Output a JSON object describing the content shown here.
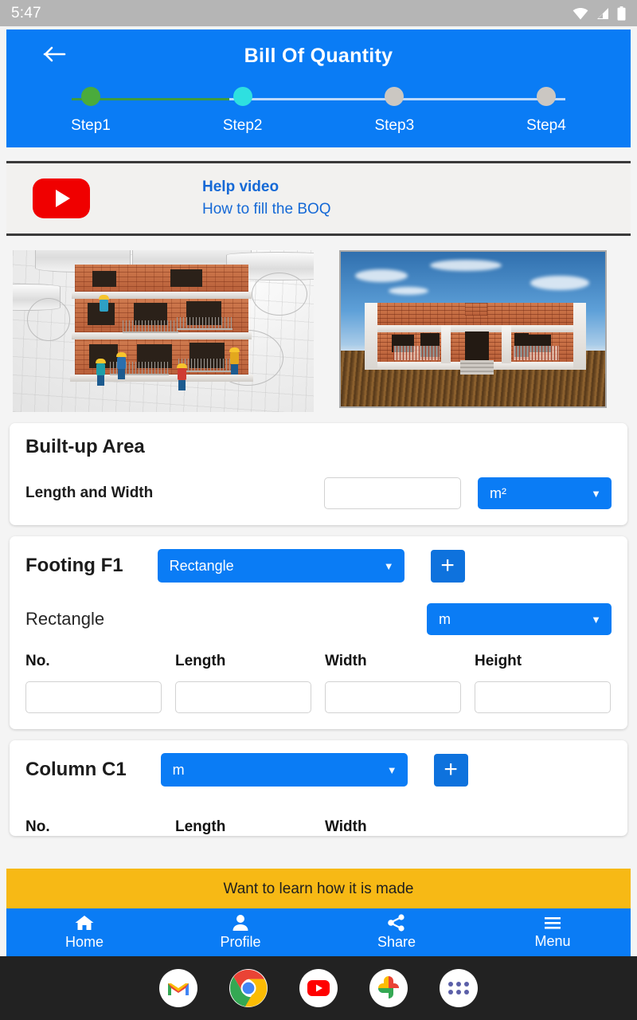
{
  "status_bar": {
    "time": "5:47",
    "icons": [
      "wifi-icon",
      "cellular-signal-icon",
      "battery-icon"
    ]
  },
  "header": {
    "back_icon": "arrow-left-icon",
    "title": "Bill Of Quantity",
    "colors": {
      "bar": "#0a7cf5",
      "step_done": "#4aab3c",
      "step_current": "#2ee0e0",
      "step_pending": "#cbc7c2"
    },
    "steps": [
      {
        "label": "Step1",
        "state": "done"
      },
      {
        "label": "Step2",
        "state": "current"
      },
      {
        "label": "Step3",
        "state": "pending"
      },
      {
        "label": "Step4",
        "state": "pending"
      }
    ]
  },
  "help_video": {
    "icon": "youtube-play-icon",
    "title": "Help video",
    "subtitle": "How to fill the BOQ"
  },
  "images": [
    {
      "name": "building-construction-blueprint-image",
      "alt": "3D building under construction on blueprints"
    },
    {
      "name": "house-render-image",
      "alt": "Rendered brick house exterior"
    }
  ],
  "built_up_area": {
    "title": "Built-up Area",
    "field_label": "Length and Width",
    "value": "",
    "placeholder": "",
    "unit": "m²"
  },
  "footing": {
    "title": "Footing F1",
    "shape": "Rectangle",
    "add_label": "+",
    "sub_label": "Rectangle",
    "unit": "m",
    "columns": [
      "No.",
      "Length",
      "Width",
      "Height"
    ],
    "values": [
      "",
      "",
      "",
      ""
    ]
  },
  "column": {
    "title": "Column C1",
    "unit": "m",
    "add_label": "+",
    "columns": [
      "No.",
      "Length",
      "Width"
    ]
  },
  "banner": {
    "text": "Want to learn how it is made",
    "color": "#f7b915"
  },
  "bottom_nav": [
    {
      "label": "Home",
      "icon": "home-icon"
    },
    {
      "label": "Profile",
      "icon": "person-icon"
    },
    {
      "label": "Share",
      "icon": "share-icon"
    },
    {
      "label": "Menu",
      "icon": "hamburger-menu-icon"
    }
  ],
  "dock": [
    {
      "name": "gmail-icon"
    },
    {
      "name": "chrome-icon"
    },
    {
      "name": "youtube-icon"
    },
    {
      "name": "google-photos-icon"
    },
    {
      "name": "app-drawer-icon"
    }
  ]
}
